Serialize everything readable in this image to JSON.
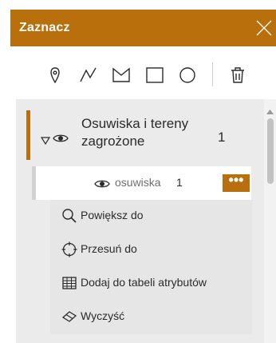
{
  "header": {
    "title": "Zaznacz",
    "close_icon": "close-icon"
  },
  "toolbar": {
    "tools": [
      "point-select-icon",
      "polyline-select-icon",
      "polygon-select-icon",
      "rectangle-select-icon",
      "circle-select-icon",
      "trash-icon"
    ]
  },
  "layer": {
    "name": "Osuwiska i tereny zagrożone",
    "count": "1"
  },
  "sublayer": {
    "name": "osuwiska",
    "count": "1",
    "more_label": "•••"
  },
  "menu": {
    "items": [
      {
        "label": "Powiększ do",
        "icon": "zoom-icon"
      },
      {
        "label": "Przesuń do",
        "icon": "pan-icon"
      },
      {
        "label": "Dodaj do tabeli atrybutów",
        "icon": "table-icon"
      },
      {
        "label": "Wyczyść",
        "icon": "eraser-icon"
      }
    ]
  },
  "colors": {
    "accent": "#b96f0b",
    "panel": "#ebebeb",
    "menu": "#e6e6e6"
  }
}
